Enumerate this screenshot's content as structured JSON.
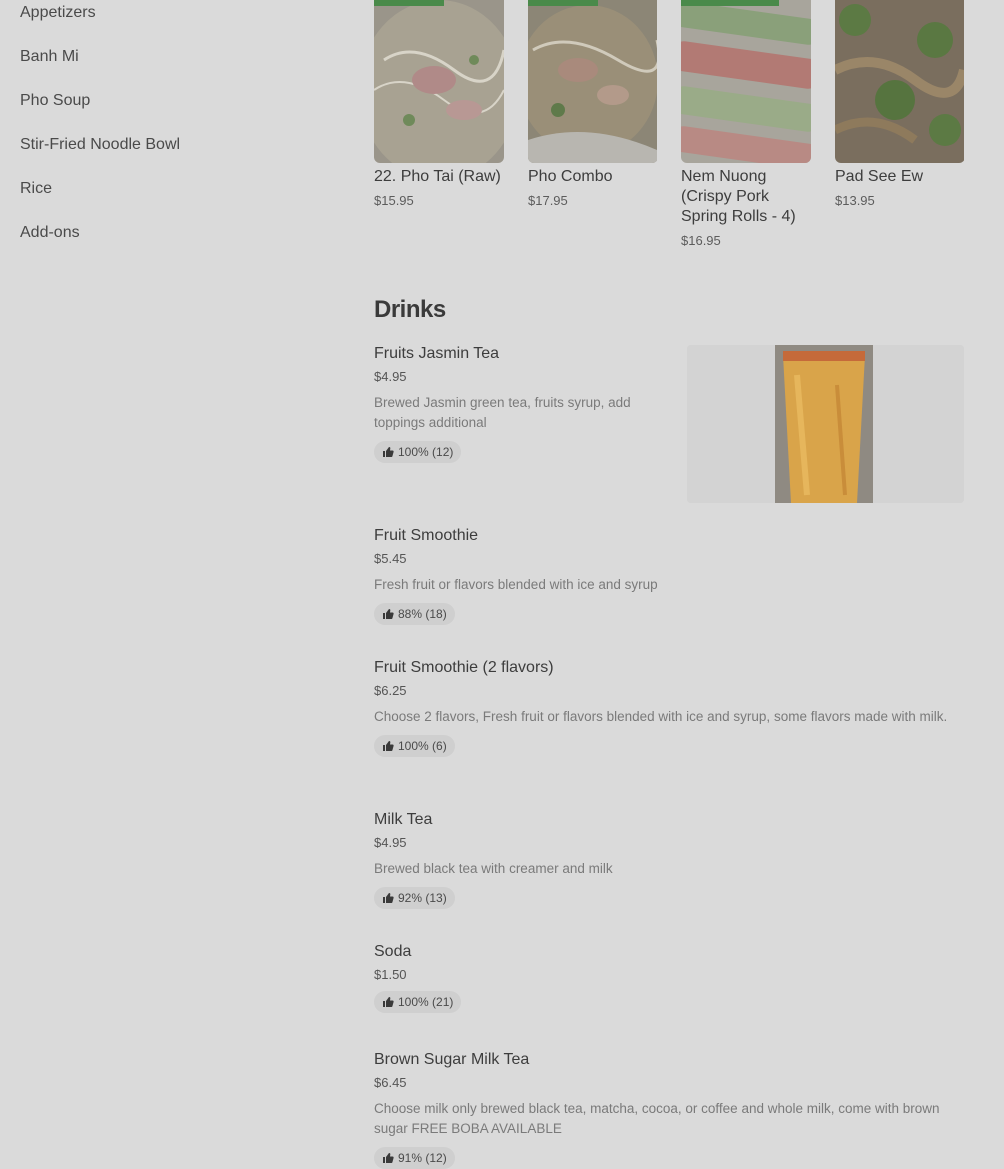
{
  "sidebar": {
    "items": [
      {
        "label": "Appetizers"
      },
      {
        "label": "Banh Mi"
      },
      {
        "label": "Pho Soup"
      },
      {
        "label": "Stir-Fried Noodle Bowl"
      },
      {
        "label": "Rice"
      },
      {
        "label": "Add-ons"
      }
    ]
  },
  "featured": [
    {
      "title": "22. Pho Tai (Raw)",
      "price": "$15.95"
    },
    {
      "title": "Pho Combo",
      "price": "$17.95"
    },
    {
      "title": "Nem Nuong (Crispy Pork Spring Rolls - 4)",
      "price": "$16.95"
    },
    {
      "title": "Pad See Ew",
      "price": "$13.95"
    }
  ],
  "drinks": {
    "title": "Drinks",
    "items": [
      {
        "name": "Fruits Jasmin Tea",
        "price": "$4.95",
        "description": "Brewed Jasmin green tea, fruits syrup, add toppings additional",
        "rating": "100% (12)"
      },
      {
        "name": "Fruit Smoothie",
        "price": "$5.45",
        "description": "Fresh fruit or flavors blended with ice and syrup",
        "rating": "88% (18)"
      },
      {
        "name": "Fruit Smoothie (2 flavors)",
        "price": "$6.25",
        "description": "Choose 2 flavors, Fresh fruit or flavors blended with ice and syrup, some flavors made with milk.",
        "rating": "100% (6)"
      },
      {
        "name": "Milk Tea",
        "price": "$4.95",
        "description": "Brewed black tea with creamer and milk",
        "rating": "92% (13)"
      },
      {
        "name": "Soda",
        "price": "$1.50",
        "description": "",
        "rating": "100% (21)"
      },
      {
        "name": "Brown Sugar Milk Tea",
        "price": "$6.45",
        "description": "Choose milk only brewed black tea, matcha, cocoa, or coffee and whole milk, come with brown sugar FREE BOBA AVAILABLE",
        "rating": "91% (12)"
      }
    ]
  },
  "colors": {
    "page_bg": "#dadada",
    "badge_bg": "#cfcfcf",
    "promo_green": "#4a8a4a"
  }
}
